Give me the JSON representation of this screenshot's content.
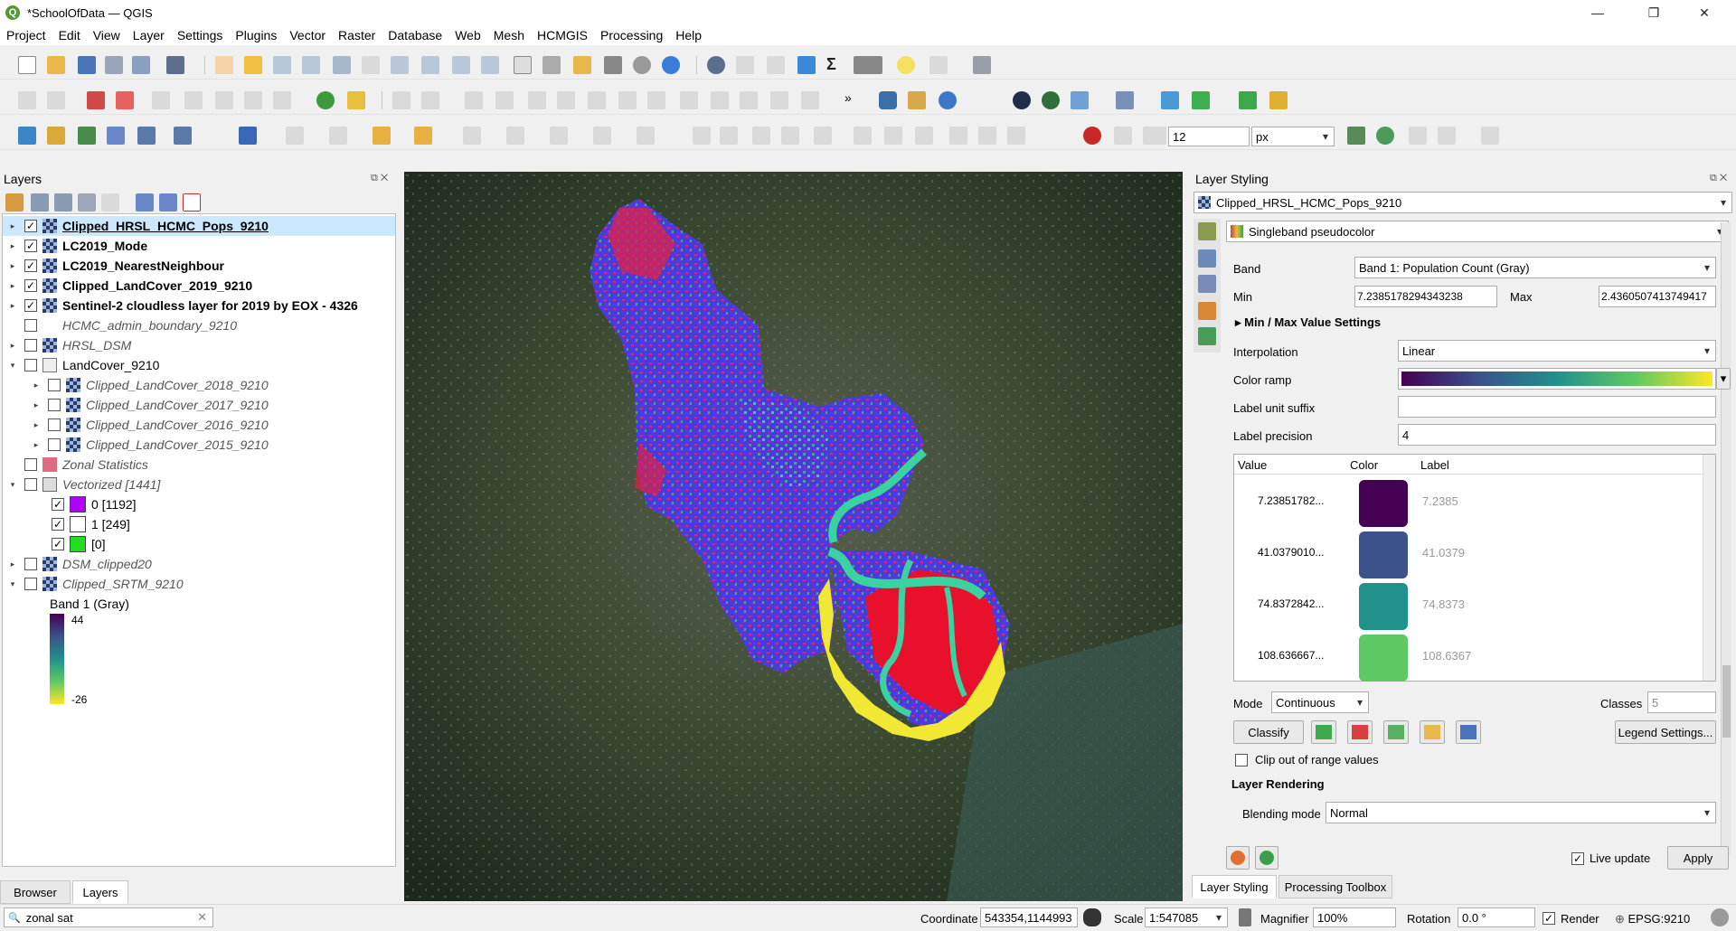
{
  "window": {
    "title": "*SchoolOfData — QGIS",
    "minimize": "—",
    "restore": "❐",
    "close": "✕"
  },
  "menu": [
    "Project",
    "Edit",
    "View",
    "Layer",
    "Settings",
    "Plugins",
    "Vector",
    "Raster",
    "Database",
    "Web",
    "Mesh",
    "HCMGIS",
    "Processing",
    "Help"
  ],
  "toolbar3": {
    "size_value": "12",
    "unit": "px"
  },
  "layers_panel": {
    "title": "Layers",
    "rows": [
      {
        "name": "Clipped_HRSL_HCMC_Pops_9210",
        "checked": true,
        "style": "bold underline",
        "expand": "▸"
      },
      {
        "name": "LC2019_Mode",
        "checked": true,
        "style": "bold",
        "expand": "▸"
      },
      {
        "name": "LC2019_NearestNeighbour",
        "checked": true,
        "style": "bold",
        "expand": "▸"
      },
      {
        "name": "Clipped_LandCover_2019_9210",
        "checked": true,
        "style": "bold",
        "expand": "▸"
      },
      {
        "name": "Sentinel-2 cloudless layer for 2019 by EOX - 4326",
        "checked": true,
        "style": "bold",
        "expand": "▸"
      },
      {
        "name": "HCMC_admin_boundary_9210",
        "checked": false,
        "style": "italic",
        "expand": ""
      },
      {
        "name": "HRSL_DSM",
        "checked": false,
        "style": "italic",
        "expand": "▸"
      },
      {
        "name": "LandCover_9210",
        "checked": false,
        "style": "group",
        "expand": "▾"
      },
      {
        "name": "Clipped_LandCover_2018_9210",
        "checked": false,
        "style": "italic",
        "expand": "▸",
        "indent": 1
      },
      {
        "name": "Clipped_LandCover_2017_9210",
        "checked": false,
        "style": "italic",
        "expand": "▸",
        "indent": 1
      },
      {
        "name": "Clipped_LandCover_2016_9210",
        "checked": false,
        "style": "italic",
        "expand": "▸",
        "indent": 1
      },
      {
        "name": "Clipped_LandCover_2015_9210",
        "checked": false,
        "style": "italic",
        "expand": "▸",
        "indent": 1
      },
      {
        "name": "Zonal Statistics",
        "checked": false,
        "style": "italic",
        "expand": ""
      },
      {
        "name": "Vectorized [1441]",
        "checked": false,
        "style": "italic",
        "expand": "▾"
      }
    ],
    "classes": [
      {
        "label": "0 [1192]",
        "color": "#b000ff",
        "checked": true
      },
      {
        "label": "1 [249]",
        "color": "#ffffff",
        "checked": true
      },
      {
        "label": "[0]",
        "color": "#22dd22",
        "checked": true
      }
    ],
    "rows_after": [
      {
        "name": "DSM_clipped20",
        "checked": false,
        "style": "italic",
        "expand": "▸"
      },
      {
        "name": "Clipped_SRTM_9210",
        "checked": false,
        "style": "italic",
        "expand": "▾"
      }
    ],
    "band_label": "Band 1 (Gray)",
    "band_max": "44",
    "band_min": "-26",
    "bottom_tabs": [
      "Browser",
      "Layers"
    ]
  },
  "styling": {
    "title": "Layer Styling",
    "layer": "Clipped_HRSL_HCMC_Pops_9210",
    "renderer": "Singleband pseudocolor",
    "band_label": "Band",
    "band_value": "Band 1: Population Count (Gray)",
    "min_label": "Min",
    "min_value": "7.2385178294343238",
    "max_label": "Max",
    "max_value": "2.4360507413749417",
    "minmax_settings": "Min / Max Value Settings",
    "interpolation_label": "Interpolation",
    "interpolation_value": "Linear",
    "color_ramp_label": "Color ramp",
    "label_unit_suffix": "Label unit suffix",
    "label_precision_label": "Label precision",
    "label_precision_value": "4",
    "table_headers": [
      "Value",
      "Color",
      "Label"
    ],
    "entries": [
      {
        "value": "7.23851782...",
        "color": "#440154",
        "label": "7.2385"
      },
      {
        "value": "41.0379010...",
        "color": "#3b528b",
        "label": "41.0379"
      },
      {
        "value": "74.8372842...",
        "color": "#21918c",
        "label": "74.8373"
      },
      {
        "value": "108.636667...",
        "color": "#5ec962",
        "label": "108.6367"
      }
    ],
    "mode_label": "Mode",
    "mode_value": "Continuous",
    "classes_label": "Classes",
    "classes_value": "5",
    "classify": "Classify",
    "legend_settings": "Legend Settings...",
    "clip_label": "Clip out of range values",
    "layer_rendering": "Layer Rendering",
    "blending_label": "Blending mode",
    "blending_value": "Normal",
    "live_update": "Live update",
    "apply": "Apply",
    "bottom_tabs": [
      "Layer Styling",
      "Processing Toolbox"
    ]
  },
  "statusbar": {
    "search": "zonal sat",
    "coordinate_label": "Coordinate",
    "coordinate_value": "543354,1144993",
    "scale_label": "Scale",
    "scale_value": "1:547085",
    "magnifier_label": "Magnifier",
    "magnifier_value": "100%",
    "rotation_label": "Rotation",
    "rotation_value": "0.0 °",
    "render_label": "Render",
    "crs": "EPSG:9210"
  },
  "colors": {
    "accent_green": "#589632",
    "selection": "#cce8ff"
  }
}
